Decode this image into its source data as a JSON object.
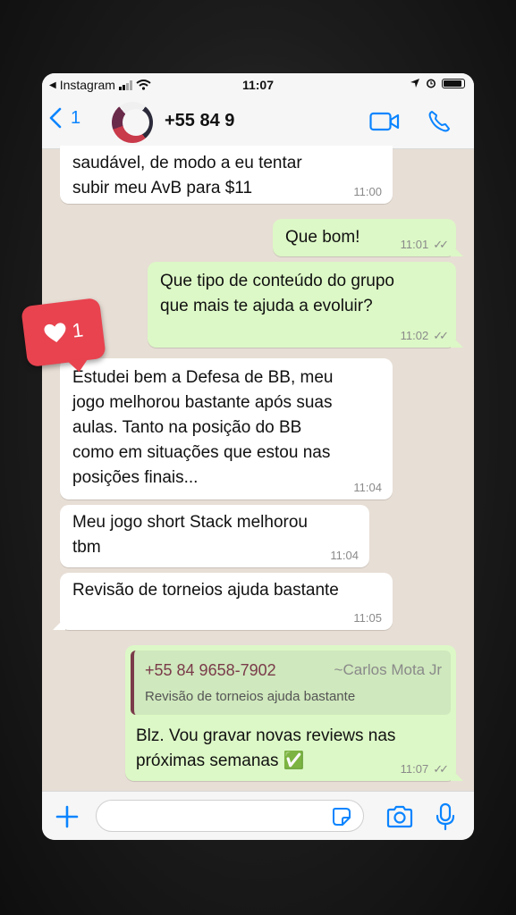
{
  "status_bar": {
    "back_app": "Instagram",
    "time": "11:07"
  },
  "header": {
    "unread_count": "1",
    "contact_name": "+55 84 9"
  },
  "like_badge": {
    "count": "1"
  },
  "messages": [
    {
      "direction": "in",
      "text": "saudável, de modo a eu tentar\nsubir meu AvB para $11",
      "time": "11:00"
    },
    {
      "direction": "out",
      "text": "Que bom!",
      "time": "11:01"
    },
    {
      "direction": "out",
      "text": "Que tipo de conteúdo do grupo\nque mais te ajuda a evoluir?",
      "time": "11:02"
    },
    {
      "direction": "in",
      "text": "Estudei bem a Defesa de BB, meu\njogo melhorou bastante após suas\naulas. Tanto na posição do BB\ncomo em situações que estou nas\nposições finais...",
      "time": "11:04"
    },
    {
      "direction": "in",
      "text": "Meu jogo short Stack melhorou\ntbm",
      "time": "11:04"
    },
    {
      "direction": "in",
      "text": "Revisão de torneios ajuda bastante",
      "time": "11:05"
    },
    {
      "direction": "out",
      "text": "Blz. Vou gravar novas reviews nas\npróximas semanas ✅",
      "time": "11:07",
      "quote": {
        "number": "+55 84 9658-7902",
        "name": "~Carlos Mota Jr",
        "text": "Revisão de torneios ajuda bastante"
      }
    }
  ],
  "input": {
    "placeholder": ""
  },
  "colors": {
    "accent": "#0a84ff",
    "outgoing_bubble": "#dcf8c6",
    "incoming_bubble": "#ffffff",
    "chat_background": "#e7ded5",
    "like_badge": "#e8434f",
    "quote_author": "#7a3b4a"
  },
  "icons": [
    "chevron-left-icon",
    "video-camera-icon",
    "phone-icon",
    "plus-icon",
    "sticker-icon",
    "camera-icon",
    "microphone-icon",
    "heart-icon",
    "location-arrow-icon",
    "alarm-icon",
    "wifi-icon",
    "signal-icon",
    "battery-icon"
  ]
}
